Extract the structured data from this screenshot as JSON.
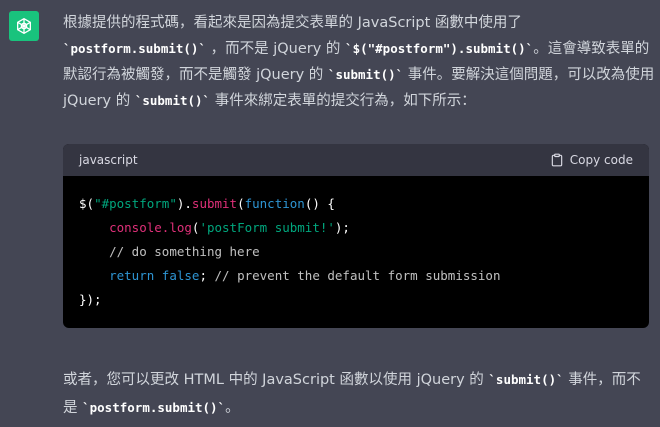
{
  "assistant": {
    "avatar_color": "#19c37d",
    "avatar_icon": "openai-logo-icon"
  },
  "paragraph1": {
    "t1": "根據提供的程式碼，看起來是因為提交表單的 JavaScript 函數中使用了",
    "c1": "`postform.submit()`",
    "t2": "，而不是 jQuery 的",
    "c2": "`$(\"#postform\").submit()`",
    "t3": "。這會導致表單的默認行為被觸發，而不是觸發 jQuery 的",
    "c3": "`submit()`",
    "t4": "事件。要解決這個問題，可以改為使用 jQuery 的",
    "c4": "`submit()`",
    "t5": "事件來綁定表單的提交行為，如下所示："
  },
  "code_block": {
    "language": "javascript",
    "copy_label": "Copy code",
    "copy_icon": "clipboard-icon",
    "lines": {
      "l1_a": "$(",
      "l1_str": "\"#postform\"",
      "l1_b": ").",
      "l1_fn": "submit",
      "l1_c": "(",
      "l1_kw": "function",
      "l1_d": "() {",
      "l2_fn": "console.log",
      "l2_a": "(",
      "l2_str": "'postForm submit!'",
      "l2_b": ");",
      "l3_cm": "// do something here",
      "l4_kw": "return",
      "l4_a": " ",
      "l4_kw2": "false",
      "l4_b": "; ",
      "l4_cm": "// prevent the default form submission",
      "l5": "});"
    }
  },
  "paragraph2": {
    "t1": "或者，您可以更改 HTML 中的 JavaScript 函數以使用 jQuery 的",
    "c1": "`submit()`",
    "t2": "事件，而不是",
    "c2": "`postform.submit()`",
    "t3": "。"
  }
}
